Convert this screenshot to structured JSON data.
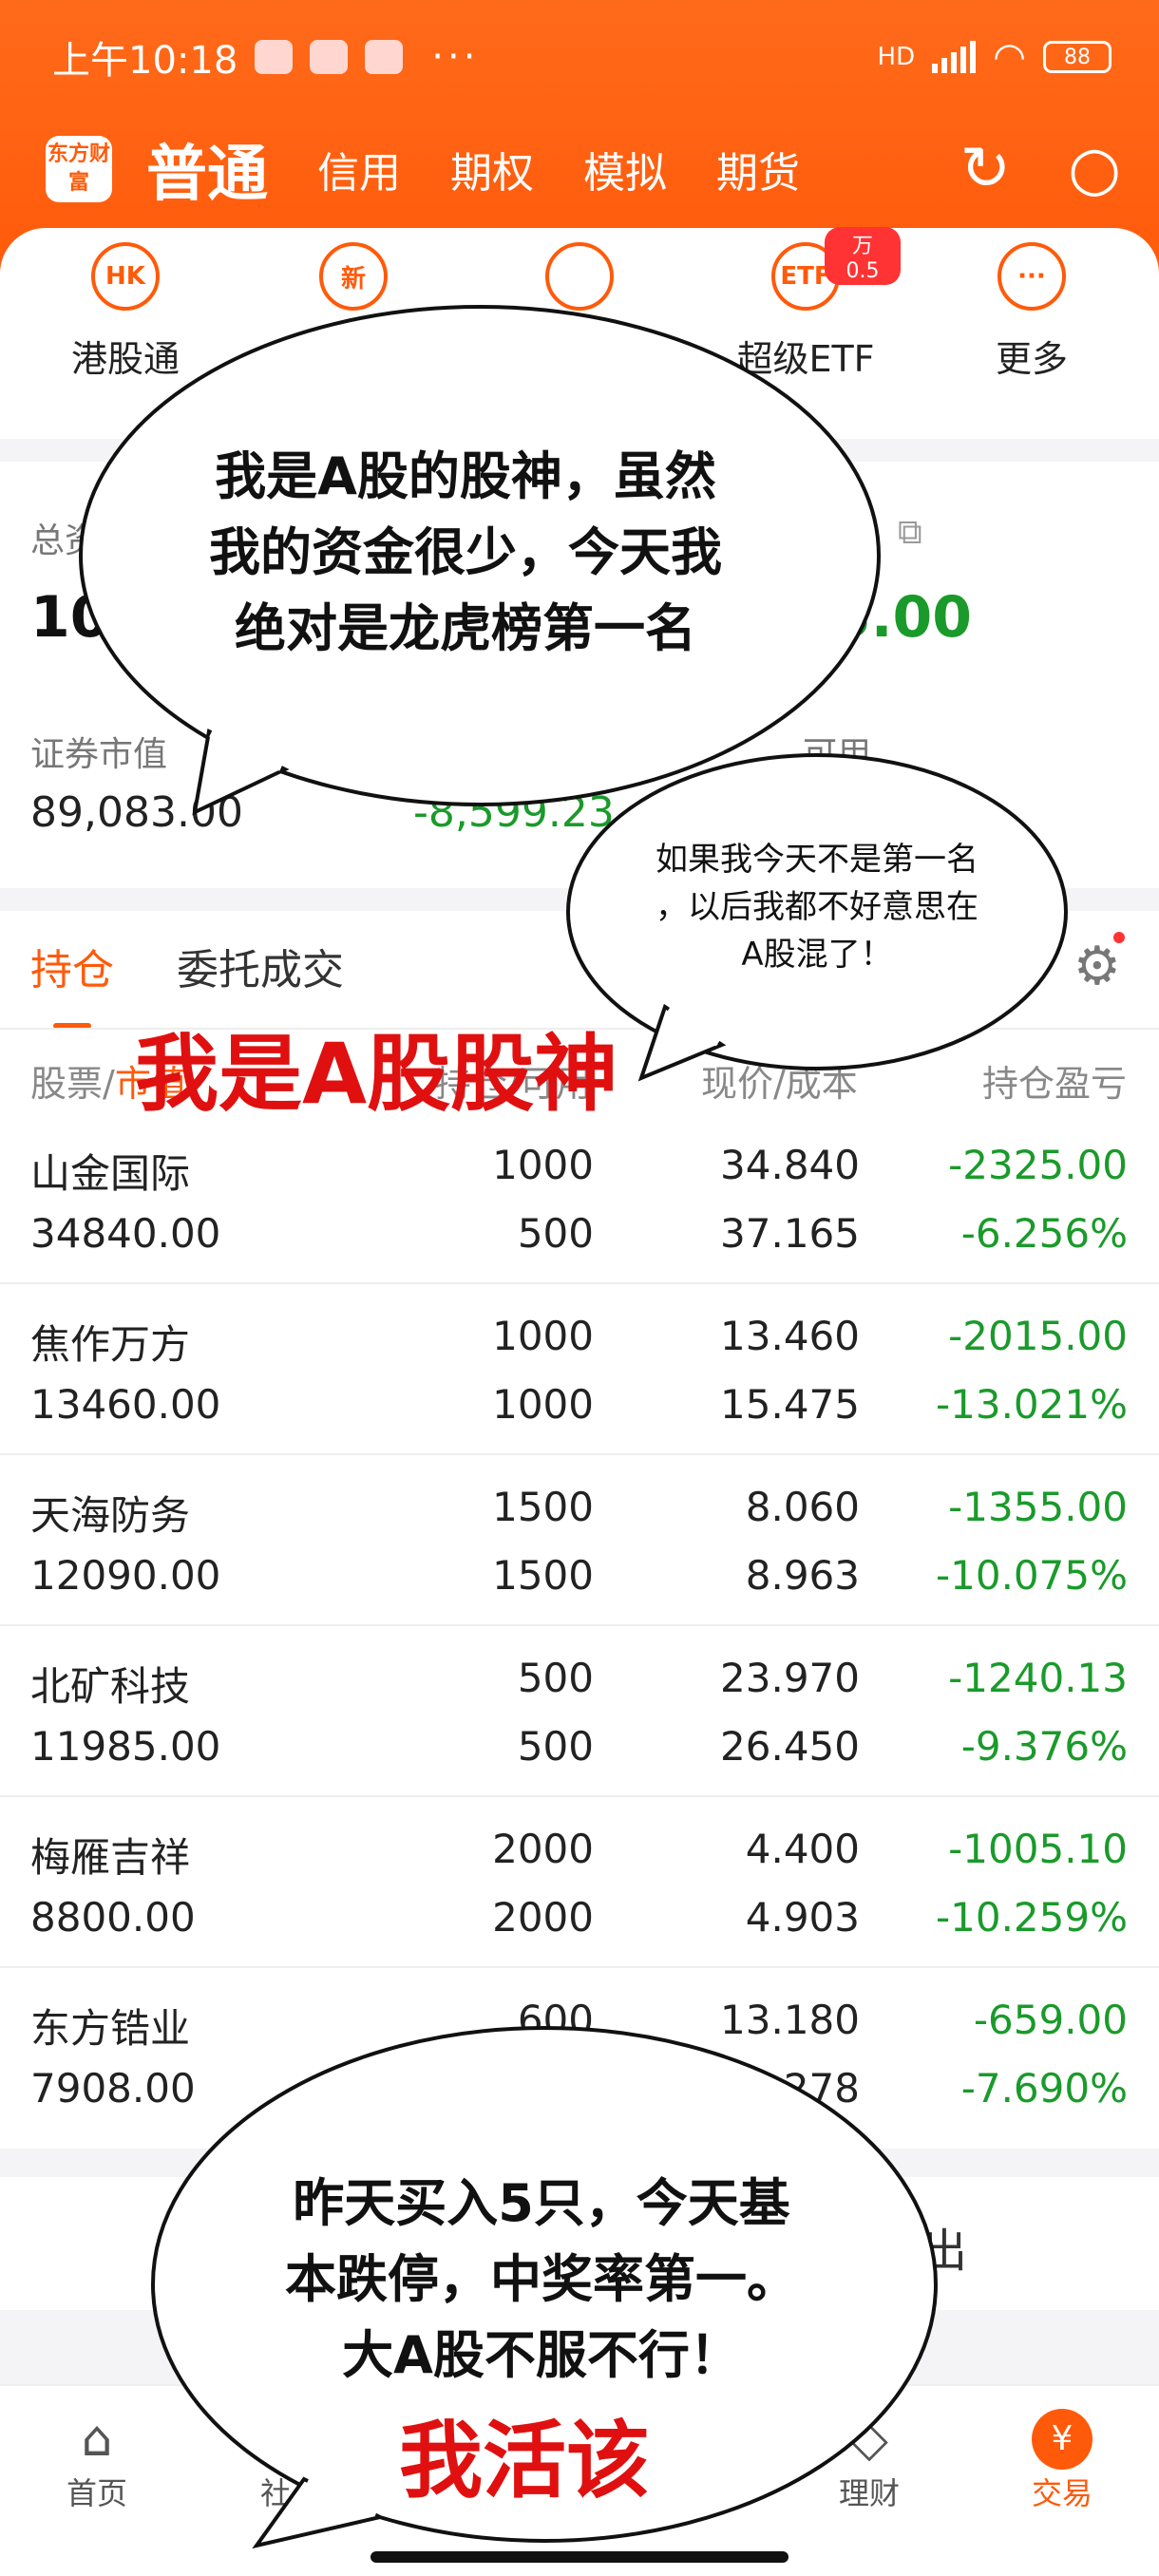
{
  "status_bar": {
    "time": "上午10:18",
    "battery": "88",
    "dots": "···"
  },
  "nav": {
    "logo": "东方财富",
    "main": "普通",
    "tabs": [
      "信用",
      "期权",
      "模拟",
      "期货"
    ],
    "refresh_icon": "refresh-icon",
    "search_icon": "search-icon"
  },
  "quick": [
    {
      "icon_text": "HK",
      "label": "港股通"
    },
    {
      "icon_text": "新",
      "label": ""
    },
    {
      "icon_text": "",
      "label": ""
    },
    {
      "icon_text": "ETF",
      "label": "超级ETF",
      "badge": "万0.5"
    },
    {
      "icon_text": "···",
      "label": "更多"
    }
  ],
  "assets": {
    "total_label_partial": "总资",
    "total_value_partial": "10",
    "pl_value_partial": "5.00",
    "market_value_label": "证券市值",
    "market_value": "89,083.00",
    "market_pl": "-8,599.23",
    "available_label": "可用"
  },
  "tabs": {
    "positions": "持仓",
    "orders": "委托成交"
  },
  "table_header": {
    "stock": "股票",
    "sep": "/",
    "market_value": "市值",
    "hold": "持仓/可用",
    "price": "现价/成本",
    "pl": "持仓盈亏"
  },
  "rows": [
    {
      "name": "山金国际",
      "mv": "34840.00",
      "hold": "1000",
      "avail": "500",
      "price": "34.840",
      "cost": "37.165",
      "pl": "-2325.00",
      "plp": "-6.256%"
    },
    {
      "name": "焦作万方",
      "mv": "13460.00",
      "hold": "1000",
      "avail": "1000",
      "price": "13.460",
      "cost": "15.475",
      "pl": "-2015.00",
      "plp": "-13.021%"
    },
    {
      "name": "天海防务",
      "mv": "12090.00",
      "hold": "1500",
      "avail": "1500",
      "price": "8.060",
      "cost": "8.963",
      "pl": "-1355.00",
      "plp": "-10.075%"
    },
    {
      "name": "北矿科技",
      "mv": "11985.00",
      "hold": "500",
      "avail": "500",
      "price": "23.970",
      "cost": "26.450",
      "pl": "-1240.13",
      "plp": "-9.376%"
    },
    {
      "name": "梅雁吉祥",
      "mv": "8800.00",
      "hold": "2000",
      "avail": "2000",
      "price": "4.400",
      "cost": "4.903",
      "pl": "-1005.10",
      "plp": "-10.259%"
    },
    {
      "name": "东方锆业",
      "mv": "7908.00",
      "hold": "600",
      "avail": "",
      "price": "13.180",
      "cost": "278",
      "pl": "-659.00",
      "plp": "-7.690%"
    }
  ],
  "exit_text": "出",
  "bottom_nav": [
    {
      "icon": "home-icon",
      "label": "首页"
    },
    {
      "icon": "",
      "label": "社"
    },
    {
      "icon": "wealth-icon",
      "label": "理财"
    },
    {
      "icon": "trade-icon",
      "label": "交易",
      "glyph": "¥"
    }
  ],
  "meme": {
    "bubble1_lines": [
      "我是A股的股神，虽然",
      "我的资金很少，今天我",
      "绝对是龙虎榜第一名"
    ],
    "bubble2_lines": [
      "如果我今天不是第一名",
      "，以后我都不好意思在",
      "A股混了！"
    ],
    "bubble3_lines": [
      "昨天买入5只，今天基",
      "本跌停，中奖率第一。",
      "大A股不服不行！"
    ],
    "red_caption_1": "我是A股股神",
    "red_caption_2": "我活该"
  },
  "colors": {
    "brand": "#ff5a0a",
    "down": "#1a9a2a",
    "caption": "#e01010"
  }
}
